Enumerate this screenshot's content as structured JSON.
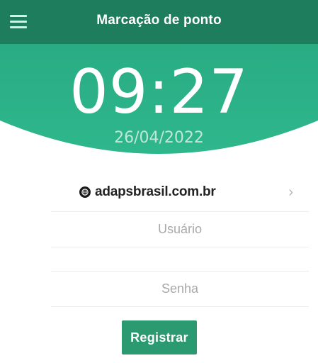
{
  "header": {
    "title": "Marcação de ponto",
    "time": "09:27",
    "date": "26/04/2022"
  },
  "login": {
    "domain": "adapsbrasil.com.br",
    "username_placeholder": "Usuário",
    "password_placeholder": "Senha",
    "register_label": "Registrar"
  },
  "colors": {
    "header_dark": "#1e7c5b",
    "header_green": "#2bb38a",
    "button": "#2c9a70"
  },
  "icons": {
    "menu": "hamburger-menu-icon",
    "globe": "globe-icon",
    "chevron": "chevron-right-icon"
  }
}
